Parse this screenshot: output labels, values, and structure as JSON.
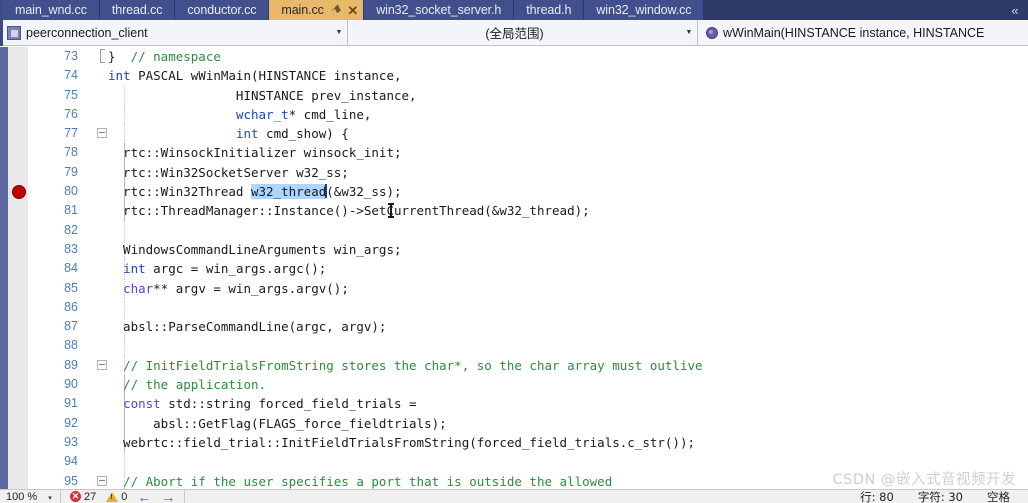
{
  "tabs": [
    {
      "label": "main_wnd.cc",
      "active": false
    },
    {
      "label": "thread.cc",
      "active": false
    },
    {
      "label": "conductor.cc",
      "active": false
    },
    {
      "label": "main.cc",
      "active": true
    },
    {
      "label": "win32_socket_server.h",
      "active": false
    },
    {
      "label": "thread.h",
      "active": false
    },
    {
      "label": "win32_window.cc",
      "active": false
    }
  ],
  "tab_overflow_label": "«",
  "active_tab_pin": "⚑",
  "active_tab_close": "✕",
  "navbar": {
    "project_combo": "peerconnection_client",
    "scope_combo": "(全局范围)",
    "symbol_combo": "wWinMain(HINSTANCE instance, HINSTANCE ",
    "arrow": "▼"
  },
  "editor": {
    "breakpoint_line": 80,
    "lines": [
      {
        "n": 73,
        "indent": 0,
        "fold": false,
        "bracket": true,
        "parts": [
          {
            "t": "}  ",
            "c": "plain"
          },
          {
            "t": "// namespace",
            "c": "cmt"
          }
        ]
      },
      {
        "n": 74,
        "indent": 0,
        "fold": false,
        "guide": false,
        "parts": [
          {
            "t": "int",
            "c": "kw"
          },
          {
            "t": " PASCAL wWinMain(HINSTANCE instance,",
            "c": "plain"
          }
        ]
      },
      {
        "n": 75,
        "indent": 0,
        "fold": false,
        "guide": true,
        "parts": [
          {
            "t": "                 HINSTANCE prev_instance,",
            "c": "plain"
          }
        ]
      },
      {
        "n": 76,
        "indent": 0,
        "fold": false,
        "guide": true,
        "parts": [
          {
            "t": "                 ",
            "c": "plain"
          },
          {
            "t": "wchar_t",
            "c": "kw"
          },
          {
            "t": "* cmd_line,",
            "c": "plain"
          }
        ]
      },
      {
        "n": 77,
        "indent": 0,
        "fold": true,
        "guide": true,
        "parts": [
          {
            "t": "                 ",
            "c": "plain"
          },
          {
            "t": "int",
            "c": "kw"
          },
          {
            "t": " cmd_show) {",
            "c": "plain"
          }
        ]
      },
      {
        "n": 78,
        "indent": 0,
        "fold": false,
        "guide": true,
        "solid": true,
        "parts": [
          {
            "t": "  rtc::WinsockInitializer winsock_init;",
            "c": "plain"
          }
        ]
      },
      {
        "n": 79,
        "indent": 0,
        "fold": false,
        "guide": true,
        "solid": true,
        "parts": [
          {
            "t": "  rtc::Win32SocketServer w32_ss;",
            "c": "plain"
          }
        ]
      },
      {
        "n": 80,
        "indent": 0,
        "fold": false,
        "guide": true,
        "solid": true,
        "parts": [
          {
            "t": "  rtc::Win32Thread ",
            "c": "plain"
          },
          {
            "t": "w32_thread",
            "c": "sel"
          },
          {
            "t": "(&w32_ss);",
            "c": "plain"
          }
        ]
      },
      {
        "n": 81,
        "indent": 0,
        "fold": false,
        "guide": true,
        "solid": true,
        "parts": [
          {
            "t": "  rtc::ThreadManager::Instance()->SetCurrentThread(&w32_thread);",
            "c": "plain"
          }
        ]
      },
      {
        "n": 82,
        "indent": 0,
        "fold": false,
        "guide": true,
        "parts": [
          {
            "t": "",
            "c": "plain"
          }
        ]
      },
      {
        "n": 83,
        "indent": 0,
        "fold": false,
        "guide": true,
        "parts": [
          {
            "t": "  WindowsCommandLineArguments win_args;",
            "c": "plain"
          }
        ]
      },
      {
        "n": 84,
        "indent": 0,
        "fold": false,
        "guide": true,
        "parts": [
          {
            "t": "  ",
            "c": "plain"
          },
          {
            "t": "int",
            "c": "kw"
          },
          {
            "t": " argc = win_args.argc();",
            "c": "plain"
          }
        ]
      },
      {
        "n": 85,
        "indent": 0,
        "fold": false,
        "guide": true,
        "parts": [
          {
            "t": "  ",
            "c": "plain"
          },
          {
            "t": "char",
            "c": "kw2"
          },
          {
            "t": "** argv = win_args.argv();",
            "c": "plain"
          }
        ]
      },
      {
        "n": 86,
        "indent": 0,
        "fold": false,
        "guide": true,
        "parts": [
          {
            "t": "",
            "c": "plain"
          }
        ]
      },
      {
        "n": 87,
        "indent": 0,
        "fold": false,
        "guide": true,
        "parts": [
          {
            "t": "  absl::ParseCommandLine(argc, argv);",
            "c": "plain"
          }
        ]
      },
      {
        "n": 88,
        "indent": 0,
        "fold": false,
        "guide": true,
        "parts": [
          {
            "t": "",
            "c": "plain"
          }
        ]
      },
      {
        "n": 89,
        "indent": 0,
        "fold": true,
        "guide": true,
        "parts": [
          {
            "t": "  // InitFieldTrialsFromString stores the char*, so the char array must outlive",
            "c": "cmt"
          }
        ]
      },
      {
        "n": 90,
        "indent": 0,
        "fold": false,
        "guide": true,
        "solid": true,
        "parts": [
          {
            "t": "  // the application.",
            "c": "cmt"
          }
        ]
      },
      {
        "n": 91,
        "indent": 0,
        "fold": false,
        "guide": true,
        "solid": true,
        "parts": [
          {
            "t": "  ",
            "c": "plain"
          },
          {
            "t": "const",
            "c": "kw2"
          },
          {
            "t": " std::string forced_field_trials =",
            "c": "plain"
          }
        ]
      },
      {
        "n": 92,
        "indent": 0,
        "fold": false,
        "guide": true,
        "solid": true,
        "parts": [
          {
            "t": "      absl::GetFlag(FLAGS_force_fieldtrials);",
            "c": "plain"
          }
        ]
      },
      {
        "n": 93,
        "indent": 0,
        "fold": false,
        "guide": true,
        "solid": true,
        "parts": [
          {
            "t": "  webrtc::field_trial::InitFieldTrialsFromString(forced_field_trials.c_str());",
            "c": "plain"
          }
        ]
      },
      {
        "n": 94,
        "indent": 0,
        "fold": false,
        "guide": true,
        "parts": [
          {
            "t": "",
            "c": "plain"
          }
        ]
      },
      {
        "n": 95,
        "indent": 0,
        "fold": true,
        "guide": true,
        "parts": [
          {
            "t": "  // Abort if the user specifies a port that is outside the allowed",
            "c": "cmt"
          }
        ]
      }
    ]
  },
  "watermark": "CSDN @嵌入式音视频开发",
  "statusbar": {
    "zoom": "100 %",
    "zoom_arrow": "▾",
    "error_count": "27",
    "warning_count": "0",
    "back_arrow": "←",
    "forward_arrow": "→",
    "row": "行: 80",
    "char": "字符: 30",
    "mode": "空格"
  },
  "colors": {
    "tab_bar_bg": "#2f3a6b",
    "tab_bg": "#41508c",
    "tab_active_bg": "#e8b96b",
    "nav_bg": "#eceff7",
    "gutter": "#e8e8e8",
    "indicator_strip": "#5d68a0",
    "linenum": "#4a7fb5",
    "keyword": "#1d44c8",
    "keyword2": "#5a3fd0",
    "comment": "#2e8b3d",
    "selection": "#add6ff",
    "breakpoint": "#c00000",
    "error": "#d13438",
    "warning": "#e8b21a"
  }
}
